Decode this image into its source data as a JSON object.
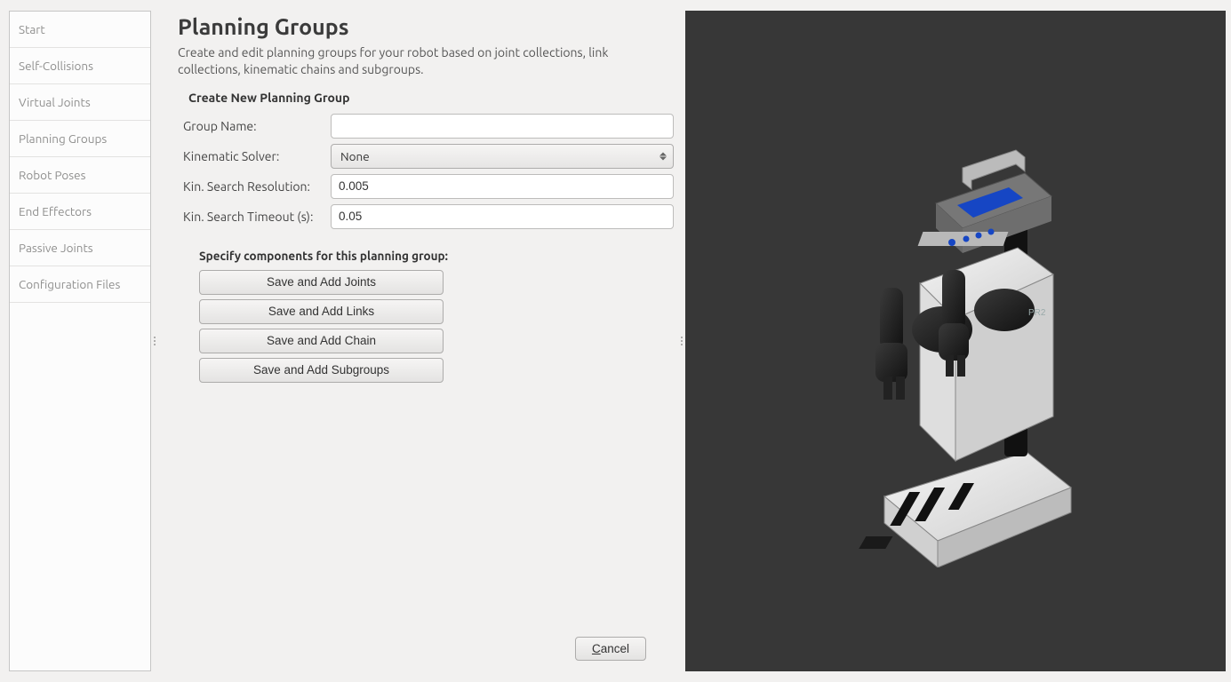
{
  "sidebar": {
    "items": [
      {
        "label": "Start"
      },
      {
        "label": "Self-Collisions"
      },
      {
        "label": "Virtual Joints"
      },
      {
        "label": "Planning Groups"
      },
      {
        "label": "Robot Poses"
      },
      {
        "label": "End Effectors"
      },
      {
        "label": "Passive Joints"
      },
      {
        "label": "Configuration Files"
      }
    ]
  },
  "main": {
    "title": "Planning Groups",
    "description": "Create and edit planning groups for your robot based on joint collections, link collections, kinematic chains and subgroups.",
    "section_title": "Create New Planning Group",
    "form": {
      "group_name_label": "Group Name:",
      "group_name_value": "",
      "kin_solver_label": "Kinematic Solver:",
      "kin_solver_value": "None",
      "kin_res_label": "Kin. Search Resolution:",
      "kin_res_value": "0.005",
      "kin_timeout_label": "Kin. Search Timeout (s):",
      "kin_timeout_value": "0.05"
    },
    "components": {
      "label": "Specify components for this planning group:",
      "buttons": [
        "Save and Add Joints",
        "Save and Add Links",
        "Save and Add Chain",
        "Save and Add Subgroups"
      ]
    },
    "cancel_label": "Cancel"
  },
  "viewport": {
    "robot_model": "PR2",
    "bg_color": "#373737"
  }
}
